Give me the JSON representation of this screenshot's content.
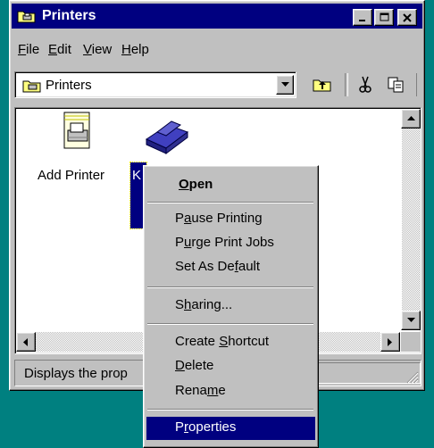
{
  "window": {
    "title": "Printers",
    "minimize_glyph": "_",
    "maximize_glyph": "□",
    "close_glyph": "✕"
  },
  "menu": {
    "file": "File",
    "edit": "Edit",
    "view": "View",
    "help": "Help"
  },
  "toolbar": {
    "address_value": "Printers",
    "dropdown_glyph": "▼",
    "up_folder_icon": "up-folder-icon",
    "cut_icon": "scissors-icon",
    "copy_icon": "copy-icon"
  },
  "content": {
    "items": [
      {
        "label": "Add Printer",
        "icon": "add-printer-icon"
      },
      {
        "label": "K",
        "icon": "printer-icon",
        "selected": true
      }
    ]
  },
  "status": {
    "text": "Displays the prop"
  },
  "context_menu": {
    "open": "Open",
    "pause_printing": "Pause Printing",
    "purge_print_jobs": "Purge Print Jobs",
    "set_as_default": "Set As Default",
    "sharing": "Sharing...",
    "create_shortcut": "Create Shortcut",
    "delete": "Delete",
    "rename": "Rename",
    "properties": "Properties",
    "highlighted_item": "Properties"
  },
  "colors": {
    "desktop": "#008080",
    "titlebar": "#000080",
    "face": "#c0c0c0",
    "highlight": "#000080"
  }
}
